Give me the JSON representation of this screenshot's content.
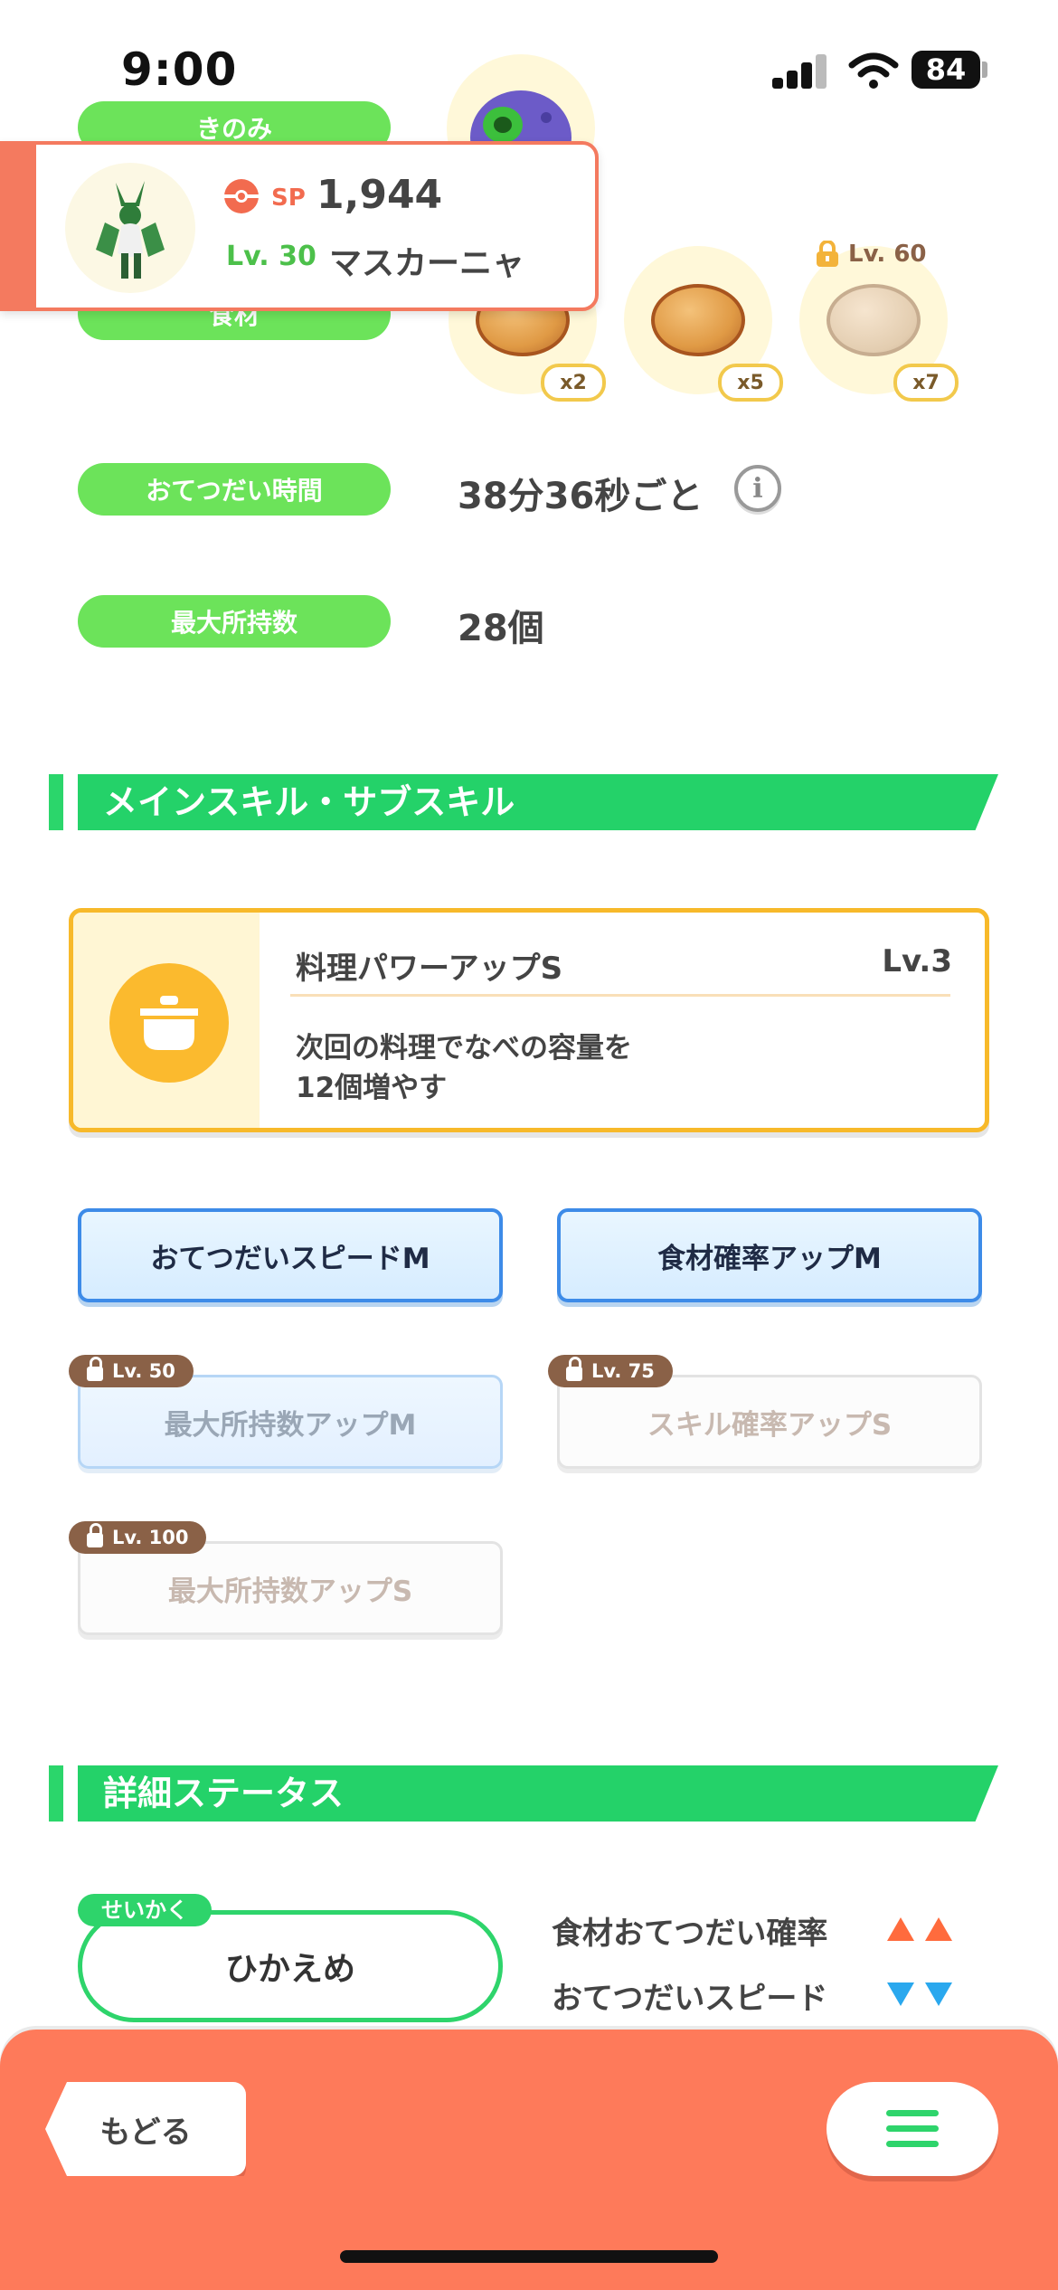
{
  "status_bar": {
    "time": "9:00",
    "battery": "84"
  },
  "rows": {
    "berry_label": "きのみ",
    "ingredient_label": "食材",
    "help_time_label": "おてつだい時間",
    "help_time_value": "38分36秒ごと",
    "max_carry_label": "最大所持数",
    "max_carry_value": "28個"
  },
  "ingredients": [
    {
      "count": "x2",
      "locked": false
    },
    {
      "count": "x5",
      "locked": false
    },
    {
      "count": "x7",
      "locked": true,
      "lock_level": "Lv. 60"
    }
  ],
  "popup": {
    "sp_label": "SP",
    "sp_value": "1,944",
    "level": "Lv. 30",
    "name": "マスカーニャ"
  },
  "sections": {
    "skills_title": "メインスキル・サブスキル",
    "details_title": "詳細ステータス"
  },
  "main_skill": {
    "name": "料理パワーアップS",
    "level": "Lv.3",
    "desc_line1": "次回の料理でなべの容量を",
    "desc_line2": "12個増やす"
  },
  "sub_skills": [
    {
      "label": "おてつだいスピードM",
      "lock": ""
    },
    {
      "label": "食材確率アップM",
      "lock": ""
    },
    {
      "label": "最大所持数アップM",
      "lock": "Lv. 50"
    },
    {
      "label": "スキル確率アップS",
      "lock": "Lv. 75"
    },
    {
      "label": "最大所持数アップS",
      "lock": "Lv. 100"
    }
  ],
  "nature": {
    "tag": "せいかく",
    "value": "ひかえめ",
    "up_label": "食材おてつだい確率",
    "down_label": "おてつだいスピード"
  },
  "footer": {
    "back_label": "もどる"
  },
  "colors": {
    "green": "#6ce35a",
    "accent": "#fe7a5a",
    "up": "#ff6b3d",
    "down": "#2aa8ee"
  }
}
